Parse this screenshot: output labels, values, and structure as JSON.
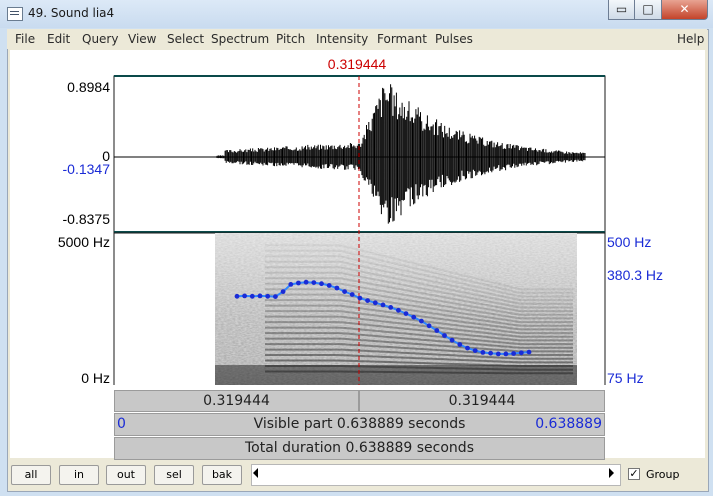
{
  "window": {
    "title": "49. Sound lia4",
    "minimize_glyph": "▭",
    "maximize_glyph": "□",
    "close_glyph": "✕"
  },
  "menu": [
    "File",
    "Edit",
    "Query",
    "View",
    "Select",
    "Spectrum",
    "Pitch",
    "Intensity",
    "Formant",
    "Pulses",
    "Help"
  ],
  "cursor_time": "0.319444",
  "waveform": {
    "top_label": "0.8984",
    "zero_label": "0",
    "cursor_value": "-0.1347",
    "bottom_label": "-0.8375"
  },
  "spectrogram": {
    "top_label": "5000 Hz",
    "bottom_label": "0 Hz",
    "pitch_top": "500 Hz",
    "pitch_value": "380.3 Hz",
    "pitch_bottom": "75 Hz"
  },
  "time_bars": {
    "left_segment": "0.319444",
    "right_segment": "0.319444",
    "visible_start": "0",
    "visible_label": "Visible part 0.638889 seconds",
    "visible_end": "0.638889",
    "total_label": "Total duration 0.638889 seconds"
  },
  "buttons": [
    "all",
    "in",
    "out",
    "sel",
    "bak"
  ],
  "group_label": "Group",
  "colors": {
    "cursor": "#cc0000",
    "pitch": "#1a2bd6",
    "pitch_line": "#2f86ff",
    "label_blue": "#1a2bd6"
  },
  "pitch_contour": {
    "unit": "Hz",
    "points": [
      [
        0.16,
        327
      ],
      [
        0.17,
        328
      ],
      [
        0.18,
        327
      ],
      [
        0.19,
        328
      ],
      [
        0.2,
        327
      ],
      [
        0.21,
        326
      ],
      [
        0.22,
        340
      ],
      [
        0.23,
        360
      ],
      [
        0.24,
        364
      ],
      [
        0.25,
        366
      ],
      [
        0.26,
        365
      ],
      [
        0.27,
        362
      ],
      [
        0.28,
        357
      ],
      [
        0.29,
        350
      ],
      [
        0.3,
        340
      ],
      [
        0.31,
        332
      ],
      [
        0.32,
        322
      ],
      [
        0.33,
        315
      ],
      [
        0.34,
        309
      ],
      [
        0.35,
        303
      ],
      [
        0.36,
        296
      ],
      [
        0.37,
        288
      ],
      [
        0.38,
        279
      ],
      [
        0.39,
        269
      ],
      [
        0.4,
        258
      ],
      [
        0.41,
        245
      ],
      [
        0.42,
        232
      ],
      [
        0.43,
        218
      ],
      [
        0.44,
        205
      ],
      [
        0.45,
        193
      ],
      [
        0.46,
        183
      ],
      [
        0.47,
        176
      ],
      [
        0.48,
        171
      ],
      [
        0.49,
        169
      ],
      [
        0.5,
        167
      ],
      [
        0.51,
        167
      ],
      [
        0.52,
        168
      ],
      [
        0.53,
        170
      ],
      [
        0.54,
        172
      ]
    ]
  }
}
